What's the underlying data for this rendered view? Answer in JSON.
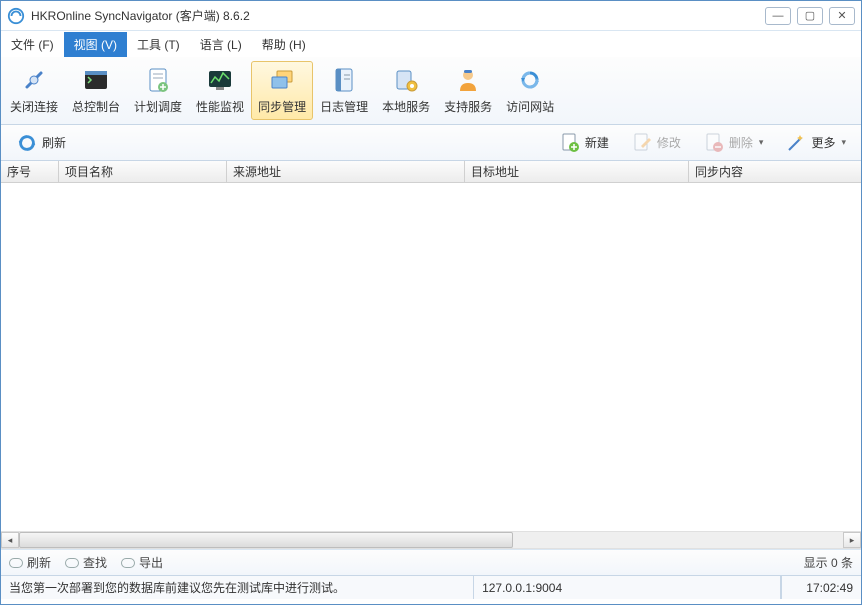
{
  "window": {
    "title": "HKROnline SyncNavigator (客户端) 8.6.2"
  },
  "menu": {
    "file": "文件 (F)",
    "view": "视图 (V)",
    "tool": "工具 (T)",
    "lang": "语言 (L)",
    "help": "帮助 (H)"
  },
  "toolbar": {
    "close_conn": "关闭连接",
    "console": "总控制台",
    "schedule": "计划调度",
    "perf": "性能监视",
    "sync_mgmt": "同步管理",
    "log_mgmt": "日志管理",
    "local_svc": "本地服务",
    "support": "支持服务",
    "website": "访问网站"
  },
  "actions": {
    "refresh": "刷新",
    "new": "新建",
    "edit": "修改",
    "delete": "删除",
    "more": "更多"
  },
  "table": {
    "headers": {
      "no": "序号",
      "name": "项目名称",
      "source": "来源地址",
      "target": "目标地址",
      "content": "同步内容"
    },
    "rows": []
  },
  "footer": {
    "refresh": "刷新",
    "find": "查找",
    "export": "导出",
    "count": "显示 0 条"
  },
  "status": {
    "message": "当您第一次部署到您的数据库前建议您先在测试库中进行测试。",
    "address": "127.0.0.1:9004",
    "time": "17:02:49"
  }
}
